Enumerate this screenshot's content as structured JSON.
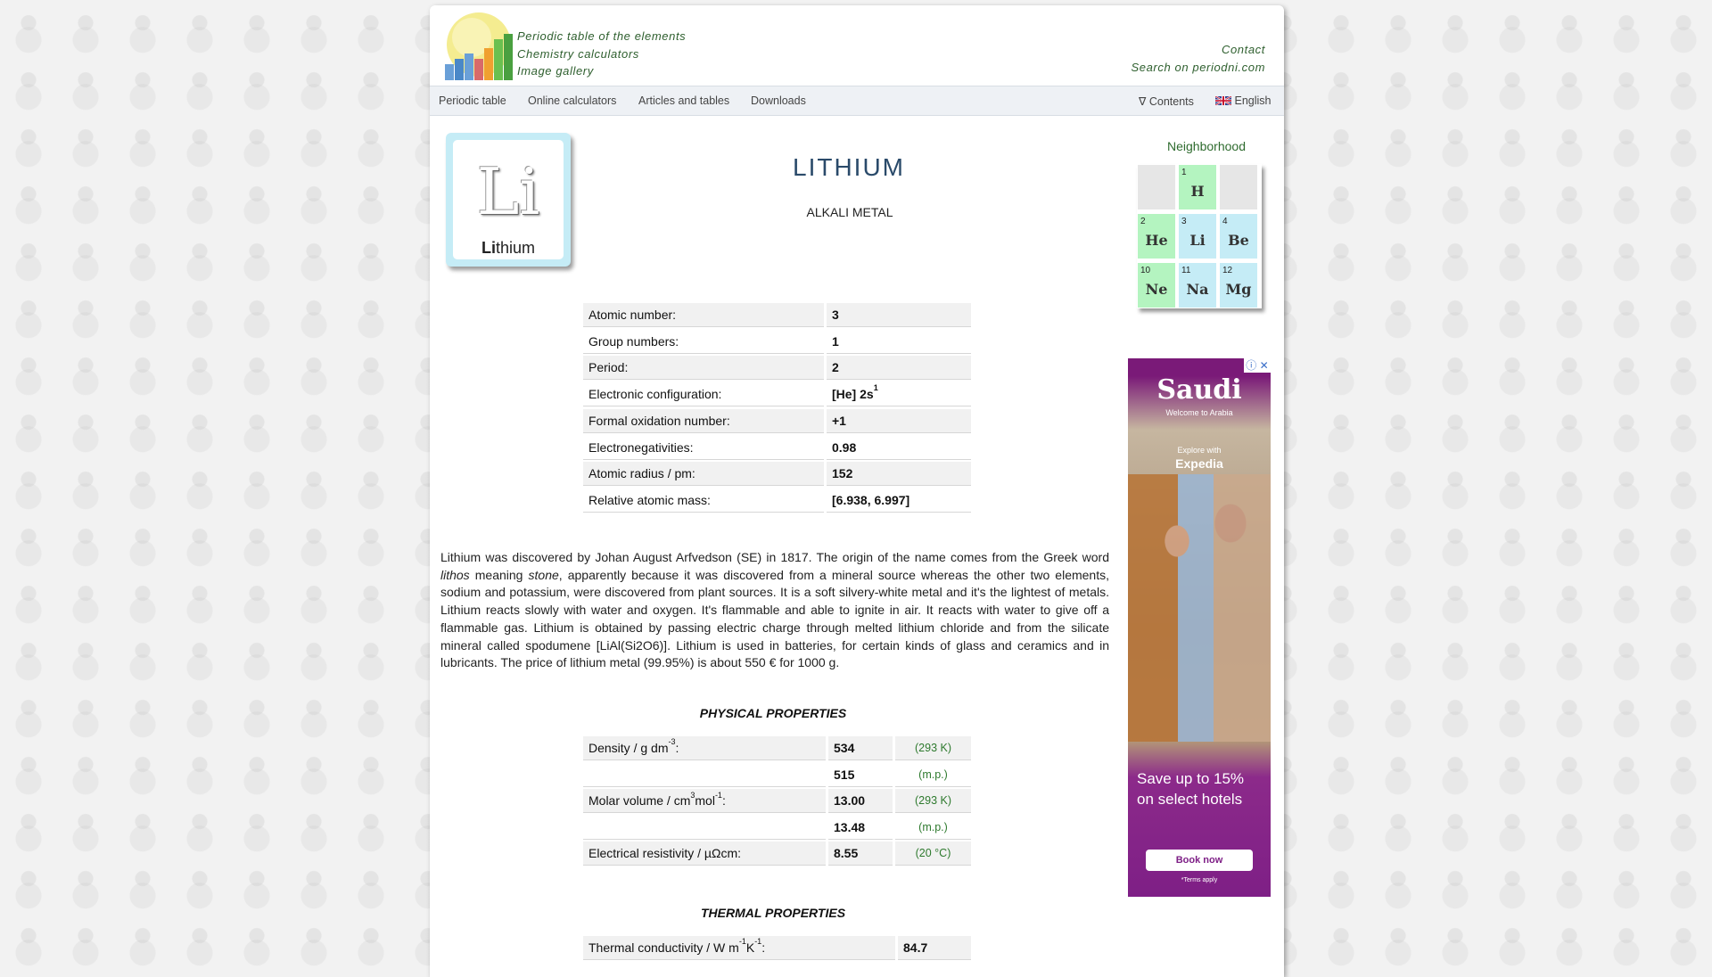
{
  "header": {
    "links": [
      "Periodic table of the elements",
      "Chemistry calculators",
      "Image gallery"
    ],
    "right_links": [
      "Contact",
      "Search on periodni.com"
    ]
  },
  "navbar": {
    "items": [
      "Periodic table",
      "Online calculators",
      "Articles and tables",
      "Downloads"
    ],
    "contents": "∇ Contents",
    "language": "English"
  },
  "element": {
    "symbol": "Li",
    "name_bold": "Li",
    "name_rest": "thium",
    "title": "LITHIUM",
    "category": "ALKALI METAL"
  },
  "neighborhood": {
    "title": "Neighborhood",
    "cells": [
      {
        "num": "",
        "sym": "",
        "color": "#e6e6e6"
      },
      {
        "num": "1",
        "sym": "H",
        "color": "#b4f4c0"
      },
      {
        "num": "",
        "sym": "",
        "color": "#e6e6e6"
      },
      {
        "num": "2",
        "sym": "He",
        "color": "#b4f4c0"
      },
      {
        "num": "3",
        "sym": "Li",
        "color": "#c5ecf6"
      },
      {
        "num": "4",
        "sym": "Be",
        "color": "#c5ecf6"
      },
      {
        "num": "10",
        "sym": "Ne",
        "color": "#b4f4c0"
      },
      {
        "num": "11",
        "sym": "Na",
        "color": "#c5ecf6"
      },
      {
        "num": "12",
        "sym": "Mg",
        "color": "#c5ecf6"
      }
    ]
  },
  "properties": [
    {
      "label": "Atomic number:",
      "value": "3"
    },
    {
      "label": "Group numbers:",
      "value": "1"
    },
    {
      "label": "Period:",
      "value": "2"
    },
    {
      "label": "Electronic configuration:",
      "value": "[He] 2s",
      "sup": "1"
    },
    {
      "label": "Formal oxidation number:",
      "value": "+1"
    },
    {
      "label": "Electronegativities:",
      "value": "0.98"
    },
    {
      "label": "Atomic radius / pm:",
      "value": "152"
    },
    {
      "label": "Relative atomic mass:",
      "value": "[6.938, 6.997]"
    }
  ],
  "description": {
    "part1": "Lithium was discovered by Johan August Arfvedson (SE) in 1817. The origin of the name comes from the Greek word ",
    "italic1": "lithos",
    "part2": " meaning ",
    "italic2": "stone",
    "part3": ", apparently because it was discovered from a mineral source whereas the other two elements, sodium and potassium, were discovered from plant sources. It is a soft silvery-white metal and it's the lightest of metals. Lithium reacts slowly with water and oxygen. It's flammable and able to ignite in air. It reacts with water to give off a flammable gas. Lithium is obtained by passing electric charge through melted lithium chloride and from the silicate mineral called spodumene [LiAl(Si2O6)]. Lithium is used in batteries, for certain kinds of glass and ceramics and in lubricants. The price of lithium metal (99.95%) is about 550 € for 1000 g."
  },
  "physical": {
    "title": "PHYSICAL PROPERTIES",
    "rows": [
      {
        "label_pre": "Density / g dm",
        "label_sup": "-3",
        "label_post": ":",
        "value": "534",
        "cond": "(293 K)"
      },
      {
        "value": "515",
        "cond": "(m.p.)"
      },
      {
        "label_pre": "Molar volume / cm",
        "label_sup": "3",
        "label_mid": "mol",
        "label_sup2": "-1",
        "label_post": ":",
        "value": "13.00",
        "cond": "(293 K)"
      },
      {
        "value": "13.48",
        "cond": "(m.p.)"
      },
      {
        "label_pre": "Electrical resistivity / µΩcm:",
        "value": "8.55",
        "cond": "(20 °C)"
      }
    ]
  },
  "thermal": {
    "title": "THERMAL PROPERTIES",
    "rows": [
      {
        "label_pre": "Thermal conductivity / W m",
        "label_sup": "-1",
        "label_mid": "K",
        "label_sup2": "-1",
        "label_post": ":",
        "value": "84.7"
      }
    ]
  },
  "ad": {
    "brand": "Saudi",
    "welcome": "Welcome to Arabia",
    "explore": "Explore with",
    "partner": "Expedia",
    "headline": "Save up to 15% on select hotels",
    "cta": "Book now",
    "terms": "*Terms apply"
  }
}
